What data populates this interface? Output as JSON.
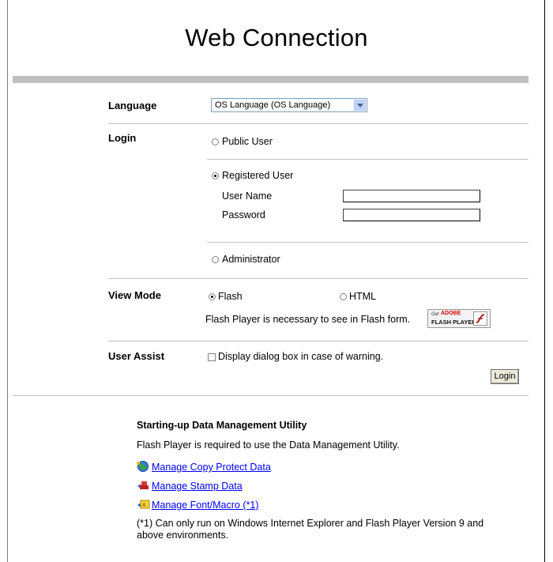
{
  "title": "Web Connection",
  "language": {
    "label": "Language",
    "selected": "OS Language (OS Language)"
  },
  "login": {
    "label": "Login",
    "public_user": "Public User",
    "registered_user": "Registered User",
    "user_name_label": "User Name",
    "password_label": "Password",
    "user_name_value": "",
    "password_value": "",
    "administrator": "Administrator",
    "selected": "Registered User"
  },
  "view_mode": {
    "label": "View Mode",
    "flash": "Flash",
    "html": "HTML",
    "selected": "Flash",
    "note": "Flash Player is necessary to see in Flash form.",
    "badge_get": "Get",
    "badge_adobe": "ADOBE",
    "badge_product": "FLASH PLAYER"
  },
  "user_assist": {
    "label": "User Assist",
    "checkbox_label": "Display dialog box in case of warning.",
    "checked": false
  },
  "login_button": "Login",
  "data_mgmt": {
    "heading": "Starting-up Data Management Utility",
    "description": "Flash Player is required to use the Data Management Utility.",
    "links": [
      "Manage Copy Protect Data",
      "Manage Stamp Data",
      "Manage Font/Macro (*1)"
    ],
    "footnote_line1": "(*1) Can only run on Windows Internet Explorer and Flash Player Version 9 and",
    "footnote_line2": "above environments."
  },
  "colors": {
    "link": "#0000ff",
    "bar": "#c0c0c0",
    "divider": "#c0c0c0"
  },
  "icons": [
    "dropdown-arrow-icon",
    "flash-player-icon",
    "globe-icon",
    "stamp-icon",
    "font-macro-icon"
  ]
}
